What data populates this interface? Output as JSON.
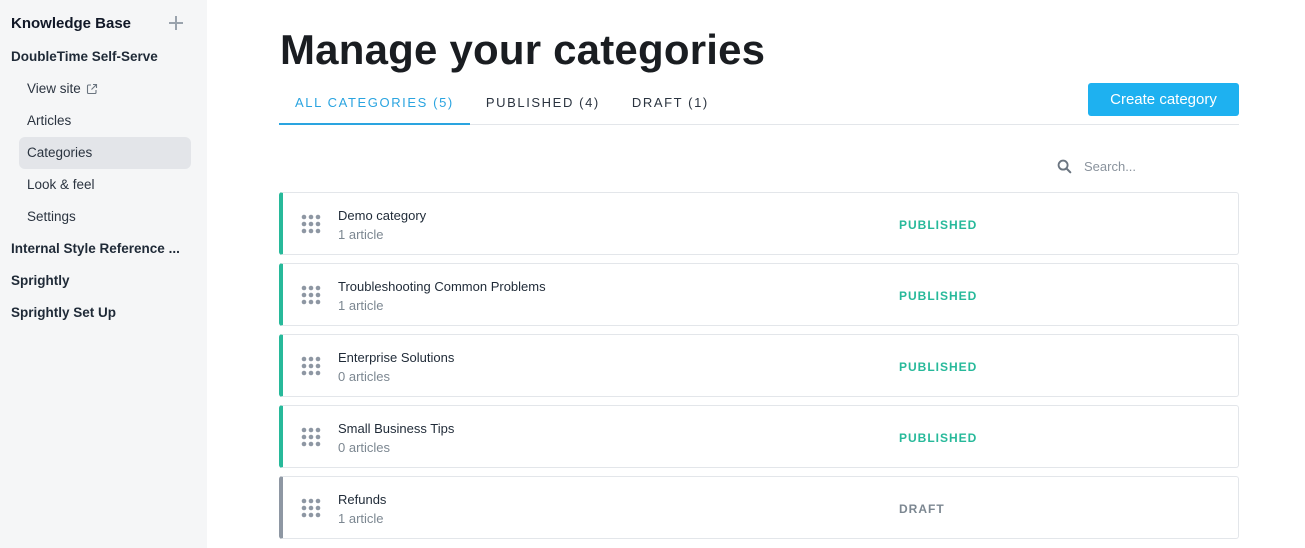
{
  "sidebar": {
    "title": "Knowledge Base",
    "groups": [
      {
        "label": "DoubleTime Self-Serve",
        "items": [
          {
            "label": "View site",
            "external": true
          },
          {
            "label": "Articles"
          },
          {
            "label": "Categories",
            "active": true
          },
          {
            "label": "Look & feel"
          },
          {
            "label": "Settings"
          }
        ]
      },
      {
        "label": "Internal Style Reference ..."
      },
      {
        "label": "Sprightly"
      },
      {
        "label": "Sprightly Set Up"
      }
    ]
  },
  "main": {
    "title": "Manage your categories",
    "tabs": [
      {
        "label": "ALL CATEGORIES (5)",
        "active": true
      },
      {
        "label": "PUBLISHED (4)"
      },
      {
        "label": "DRAFT (1)"
      }
    ],
    "create_button": "Create category",
    "search": {
      "placeholder": "Search...",
      "value": ""
    },
    "categories": [
      {
        "name": "Demo category",
        "count": "1 article",
        "status": "PUBLISHED"
      },
      {
        "name": "Troubleshooting Common Problems",
        "count": "1 article",
        "status": "PUBLISHED"
      },
      {
        "name": "Enterprise Solutions",
        "count": "0 articles",
        "status": "PUBLISHED"
      },
      {
        "name": "Small Business Tips",
        "count": "0 articles",
        "status": "PUBLISHED"
      },
      {
        "name": "Refunds",
        "count": "1 article",
        "status": "DRAFT"
      }
    ]
  },
  "colors": {
    "accent": "#1eb1f0",
    "tab_active": "#2aa4e0",
    "published": "#27b99a",
    "draft": "#8e97a3",
    "sidebar_bg": "#f5f6f7"
  },
  "icons": {
    "add": "plus-icon",
    "external": "external-link-icon",
    "search": "search-icon",
    "drag": "drag-handle-icon"
  }
}
